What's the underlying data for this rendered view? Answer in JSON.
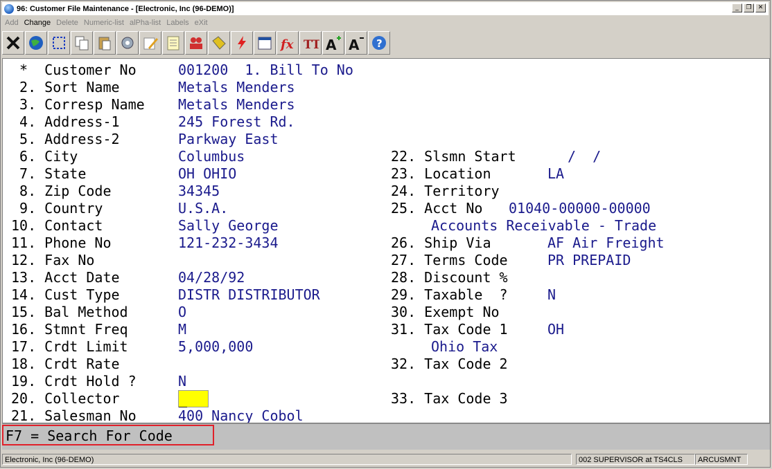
{
  "window": {
    "title": "96: Customer File Maintenance - [Electronic, Inc (96-DEMO)]"
  },
  "menu": [
    {
      "label": "Add",
      "active": false
    },
    {
      "label": "Change",
      "active": true
    },
    {
      "label": "Delete",
      "active": false
    },
    {
      "label": "Numeric-list",
      "active": false
    },
    {
      "label": "alPha-list",
      "active": false
    },
    {
      "label": "Labels",
      "active": false
    },
    {
      "label": "eXit",
      "active": false
    }
  ],
  "toolbar_icons": [
    "close-x-icon",
    "globe-icon",
    "select-box-icon",
    "copy-icon",
    "paste-icon",
    "settings-gear-icon",
    "edit-pencil-icon",
    "notepad-icon",
    "users-icon",
    "tag-icon",
    "lightning-icon",
    "calendar-icon",
    "function-icon",
    "text-format-icon",
    "font-increase-icon",
    "font-decrease-icon",
    "help-icon"
  ],
  "left_fields": [
    {
      "label": " *  Customer No",
      "value": "001200  1. Bill To No"
    },
    {
      "label": " 2. Sort Name",
      "value": "Metals Menders"
    },
    {
      "label": " 3. Corresp Name",
      "value": "Metals Menders"
    },
    {
      "label": " 4. Address-1",
      "value": "245 Forest Rd."
    },
    {
      "label": " 5. Address-2",
      "value": "Parkway East"
    },
    {
      "label": " 6. City",
      "value": "Columbus"
    },
    {
      "label": " 7. State",
      "value": "OH OHIO"
    },
    {
      "label": " 8. Zip Code",
      "value": "34345"
    },
    {
      "label": " 9. Country",
      "value": "U.S.A."
    },
    {
      "label": "10. Contact",
      "value": "Sally George"
    },
    {
      "label": "11. Phone No",
      "value": "121-232-3434"
    },
    {
      "label": "12. Fax No",
      "value": ""
    },
    {
      "label": "13. Acct Date",
      "value": "04/28/92"
    },
    {
      "label": "14. Cust Type",
      "value": "DISTR DISTRIBUTOR"
    },
    {
      "label": "15. Bal Method",
      "value": "O"
    },
    {
      "label": "16. Stmnt Freq",
      "value": "M"
    },
    {
      "label": "17. Crdt Limit",
      "value": "5,000,000"
    },
    {
      "label": "18. Crdt Rate",
      "value": ""
    },
    {
      "label": "19. Crdt Hold ?",
      "value": "N"
    },
    {
      "label": "20. Collector",
      "value": "_"
    },
    {
      "label": "21. Salesman No",
      "value": "400 Nancy Cobol"
    }
  ],
  "right_fields": [
    {
      "row": 5,
      "label": "22. Slsmn Start",
      "value": "/  /"
    },
    {
      "row": 6,
      "label": "23. Location",
      "value": "LA"
    },
    {
      "row": 7,
      "label": "24. Territory",
      "value": ""
    },
    {
      "row": 8,
      "label": "25. Acct No",
      "value": "01040-00000-00000"
    },
    {
      "row": 9,
      "label": "",
      "value": "Accounts Receivable - Trade"
    },
    {
      "row": 10,
      "label": "26. Ship Via",
      "value": "AF Air Freight"
    },
    {
      "row": 11,
      "label": "27. Terms Code",
      "value": "PR PREPAID"
    },
    {
      "row": 12,
      "label": "28. Discount %",
      "value": ""
    },
    {
      "row": 13,
      "label": "29. Taxable  ?",
      "value": "N"
    },
    {
      "row": 14,
      "label": "30. Exempt No",
      "value": ""
    },
    {
      "row": 15,
      "label": "31. Tax Code 1",
      "value": "OH"
    },
    {
      "row": 16,
      "label": "",
      "value": "Ohio Tax"
    },
    {
      "row": 17,
      "label": "32. Tax Code 2",
      "value": ""
    },
    {
      "row": 19,
      "label": "33. Tax Code 3",
      "value": ""
    }
  ],
  "hint": "F7 = Search For Code",
  "status": {
    "company": "Electronic, Inc (96-DEMO)",
    "user": "002 SUPERVISOR at TS4CLS",
    "program": "ARCUSMNT"
  },
  "colors": {
    "value_text": "#1a1a8c",
    "highlight": "#ffff00",
    "hint_border": "#e0202a"
  }
}
